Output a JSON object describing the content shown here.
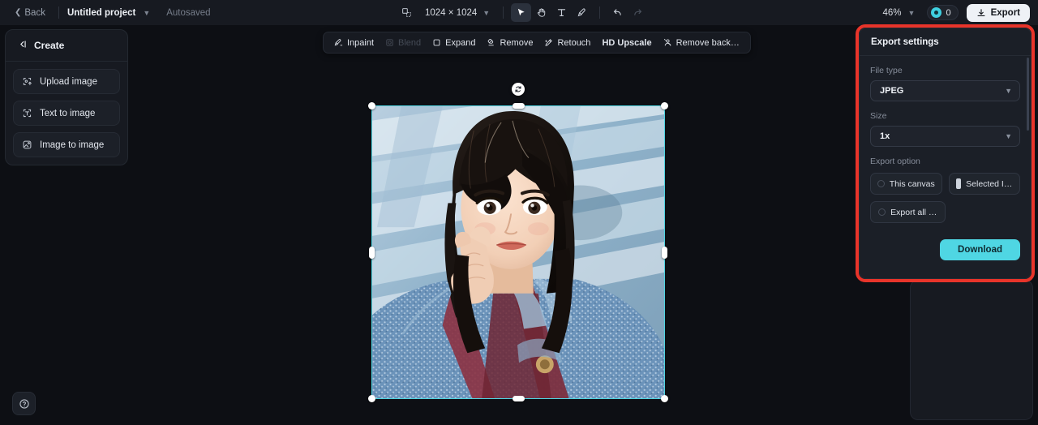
{
  "topbar": {
    "back_label": "Back",
    "project_name": "Untitled project",
    "autosaved_label": "Autosaved",
    "canvas_size": "1024 × 1024",
    "zoom_level": "46%",
    "credits_count": "0",
    "export_label": "Export",
    "tools": [
      {
        "name": "select-tool",
        "icon": "cursor-icon",
        "active": true
      },
      {
        "name": "hand-tool",
        "icon": "hand-icon",
        "active": false
      },
      {
        "name": "text-tool",
        "icon": "text-icon",
        "active": false
      },
      {
        "name": "brush-tool",
        "icon": "brush-icon",
        "active": false
      }
    ],
    "undo_label": "Undo",
    "redo_label": "Redo"
  },
  "sidebar": {
    "header": "Create",
    "items": [
      {
        "label": "Upload image",
        "icon": "upload-image-icon"
      },
      {
        "label": "Text to image",
        "icon": "text-to-image-icon"
      },
      {
        "label": "Image to image",
        "icon": "image-to-image-icon"
      }
    ]
  },
  "action_toolbar": {
    "items": [
      {
        "label": "Inpaint",
        "icon": "inpaint-icon",
        "disabled": false
      },
      {
        "label": "Blend",
        "icon": "blend-icon",
        "disabled": true
      },
      {
        "label": "Expand",
        "icon": "expand-icon",
        "disabled": false
      },
      {
        "label": "Remove",
        "icon": "remove-icon",
        "disabled": false
      },
      {
        "label": "Retouch",
        "icon": "retouch-icon",
        "disabled": false
      },
      {
        "label": "HD Upscale",
        "icon": "hd-upscale-icon",
        "disabled": false
      },
      {
        "label": "Remove back…",
        "icon": "remove-background-icon",
        "disabled": false
      }
    ]
  },
  "canvas": {
    "selected_image_alt": "Portrait photo of a young woman resting her chin on her hand, wearing a blue denim jacket and dark red overalls, seated outdoors near metal railings",
    "rotate_handle_label": "Rotate"
  },
  "export_settings": {
    "title": "Export settings",
    "file_type_label": "File type",
    "file_type_value": "JPEG",
    "size_label": "Size",
    "size_value": "1x",
    "export_option_label": "Export option",
    "options": [
      {
        "label": "This canvas",
        "icon": "radio-icon",
        "selected": false
      },
      {
        "label": "Selected I…",
        "icon": "image-bar-icon",
        "selected": true
      },
      {
        "label": "Export all …",
        "icon": "radio-icon",
        "selected": false
      }
    ],
    "download_label": "Download",
    "highlight_color": "#e8342a",
    "accent_color": "#4fd6e3"
  },
  "help": {
    "label": "Help"
  }
}
